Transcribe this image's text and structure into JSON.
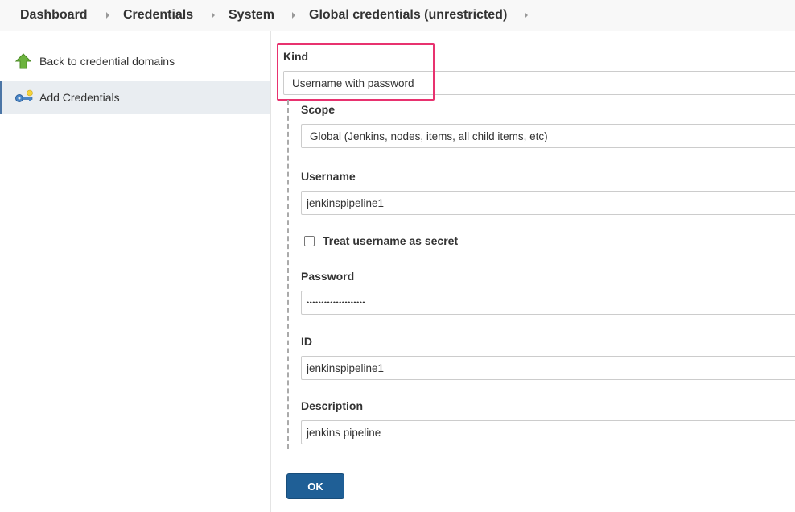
{
  "breadcrumb": {
    "items": [
      "Dashboard",
      "Credentials",
      "System",
      "Global credentials (unrestricted)"
    ]
  },
  "sidebar": {
    "tasks": [
      {
        "label": "Back to credential domains",
        "icon": "up-arrow-icon"
      },
      {
        "label": "Add Credentials",
        "icon": "key-icon"
      }
    ]
  },
  "form": {
    "kind": {
      "label": "Kind",
      "value": "Username with password"
    },
    "scope": {
      "label": "Scope",
      "value": "Global (Jenkins, nodes, items, all child items, etc)"
    },
    "username": {
      "label": "Username",
      "value": "jenkinspipeline1"
    },
    "username_secret": {
      "label": "Treat username as secret",
      "checked": false
    },
    "password": {
      "label": "Password",
      "value": "••••••••••••••••••••"
    },
    "id": {
      "label": "ID",
      "value": "jenkinspipeline1"
    },
    "description": {
      "label": "Description",
      "value": "jenkins pipeline"
    },
    "ok_label": "OK"
  },
  "colors": {
    "highlight": "#e8326f",
    "button": "#1f5f96",
    "selected_task_bg": "#e9edf1"
  }
}
